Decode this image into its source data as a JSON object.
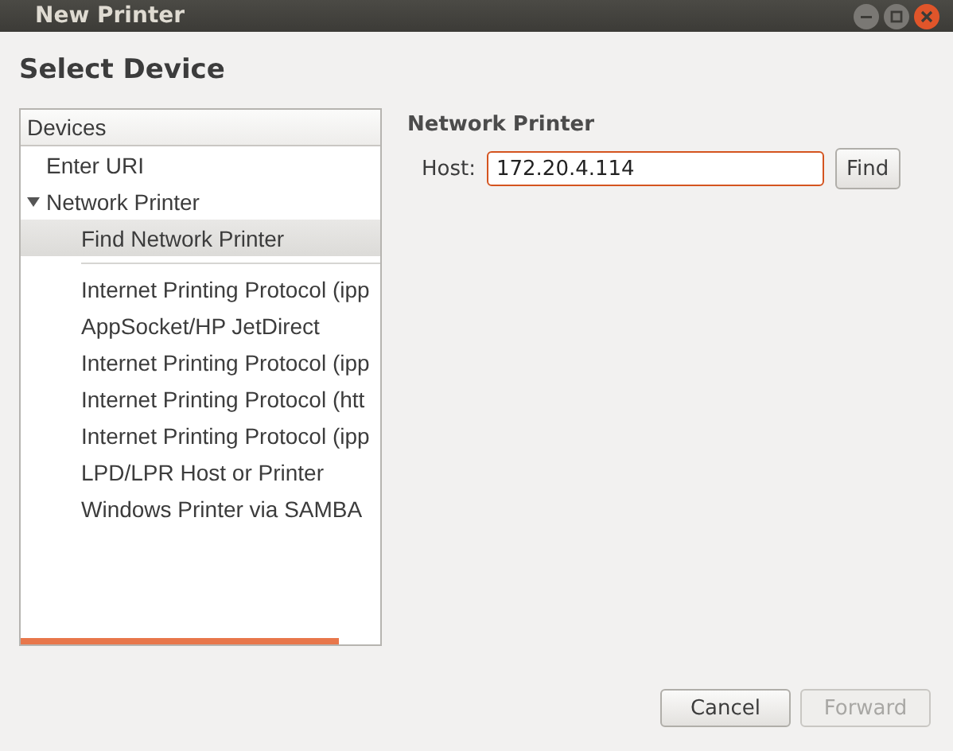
{
  "window": {
    "title": "New Printer"
  },
  "heading": "Select Device",
  "devices": {
    "header": "Devices",
    "items": [
      {
        "label": "Enter URI",
        "kind": "item",
        "selected": false
      },
      {
        "label": "Network Printer",
        "kind": "item",
        "selected": false,
        "expanded": true,
        "children": [
          {
            "label": "Find Network Printer",
            "kind": "item",
            "selected": true
          },
          {
            "kind": "separator"
          },
          {
            "label": "Internet Printing Protocol (ipp",
            "kind": "item",
            "selected": false
          },
          {
            "label": "AppSocket/HP JetDirect",
            "kind": "item",
            "selected": false
          },
          {
            "label": "Internet Printing Protocol (ipp",
            "kind": "item",
            "selected": false
          },
          {
            "label": "Internet Printing Protocol (htt",
            "kind": "item",
            "selected": false
          },
          {
            "label": "Internet Printing Protocol (ipp",
            "kind": "item",
            "selected": false
          },
          {
            "label": "LPD/LPR Host or Printer",
            "kind": "item",
            "selected": false
          },
          {
            "label": "Windows Printer via SAMBA",
            "kind": "item",
            "selected": false
          }
        ]
      }
    ]
  },
  "detail": {
    "title": "Network Printer",
    "host_label": "Host:",
    "host_value": "172.20.4.114",
    "find_button": "Find"
  },
  "buttons": [
    {
      "label": "Cancel",
      "disabled": false
    },
    {
      "label": "Forward",
      "disabled": true
    }
  ]
}
